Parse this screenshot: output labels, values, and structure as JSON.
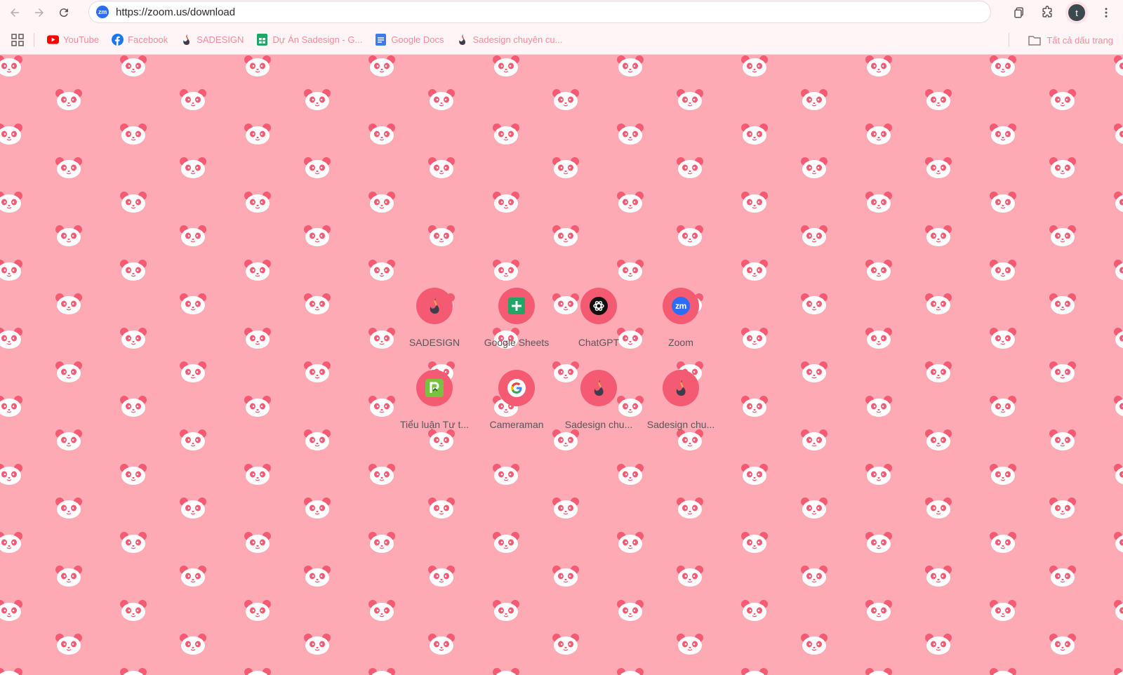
{
  "browser": {
    "url": "https://zoom.us/download",
    "site_badge": "zm",
    "profile_initial": "t"
  },
  "bookmarks": {
    "items": [
      {
        "label": "YouTube",
        "icon": "youtube-icon"
      },
      {
        "label": "Facebook",
        "icon": "facebook-icon"
      },
      {
        "label": "SADESIGN",
        "icon": "sadesign-icon"
      },
      {
        "label": "Dự Án Sadesign - G...",
        "icon": "google-sheets-icon"
      },
      {
        "label": "Google Docs",
        "icon": "google-docs-icon"
      },
      {
        "label": "Sadesign chuyên cu...",
        "icon": "sadesign-icon"
      }
    ],
    "all_bookmarks": "Tất cả dấu trang"
  },
  "shortcuts": [
    {
      "label": "SADESIGN",
      "icon": "sadesign-icon"
    },
    {
      "label": "Google Sheets",
      "icon": "google-sheets-icon"
    },
    {
      "label": "ChatGPT",
      "icon": "chatgpt-icon"
    },
    {
      "label": "Zoom",
      "icon": "zoom-icon"
    },
    {
      "label": "Tiểu luận Tư t...",
      "icon": "pdf-editor-icon"
    },
    {
      "label": "Cameraman",
      "icon": "google-icon"
    },
    {
      "label": "Sadesign chu...",
      "icon": "sadesign-icon"
    },
    {
      "label": "Sadesign chu...",
      "icon": "sadesign-icon"
    }
  ],
  "colors": {
    "wallpaper": "#feaab5",
    "tile_circle": "#f45a72",
    "bookmark_text": "#f48b9b"
  }
}
